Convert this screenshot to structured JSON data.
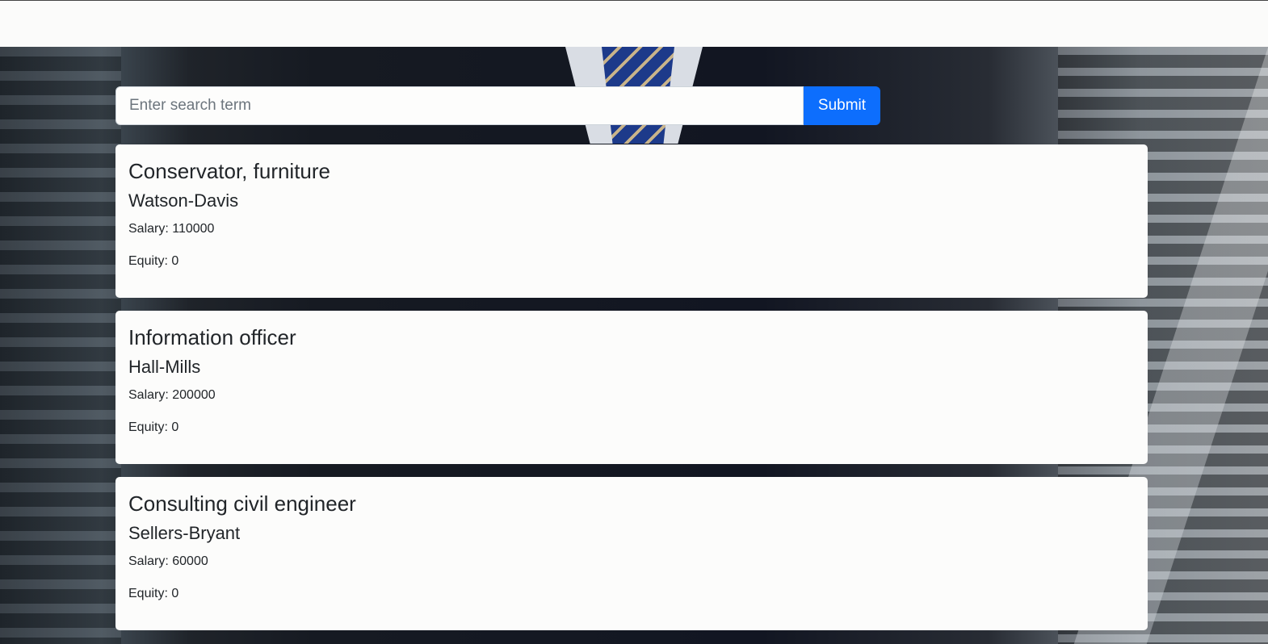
{
  "colors": {
    "primary": "#0d6efd",
    "card_background": "#fcfcfb",
    "topbar_background": "#fbfbfa"
  },
  "search": {
    "placeholder": "Enter search term",
    "value": "",
    "submit_label": "Submit"
  },
  "jobs": [
    {
      "title": "Conservator, furniture",
      "company": "Watson-Davis",
      "salary": "Salary: 110000",
      "equity": "Equity: 0"
    },
    {
      "title": "Information officer",
      "company": "Hall-Mills",
      "salary": "Salary: 200000",
      "equity": "Equity: 0"
    },
    {
      "title": "Consulting civil engineer",
      "company": "Sellers-Bryant",
      "salary": "Salary: 60000",
      "equity": "Equity: 0"
    }
  ]
}
